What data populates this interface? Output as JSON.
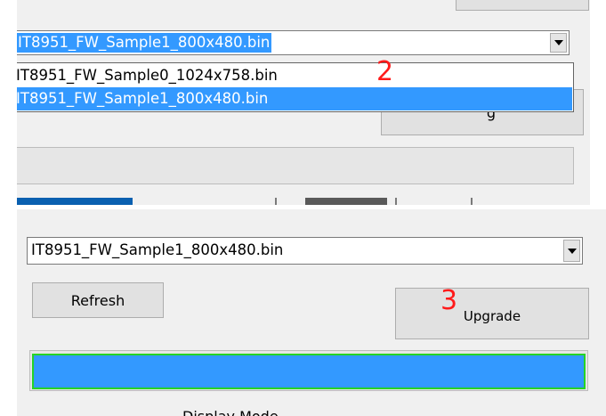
{
  "top": {
    "combo_value": "IT8951_FW_Sample1_800x480.bin",
    "dropdown_items": [
      "IT8951_FW_Sample0_1024x758.bin",
      "IT8951_FW_Sample1_800x480.bin"
    ],
    "step_annotation": "2",
    "partial_button_label": "g"
  },
  "bottom": {
    "combo_value": "IT8951_FW_Sample1_800x480.bin",
    "refresh_label": "Refresh",
    "upgrade_label": "Upgrade",
    "step_annotation": "3",
    "progress_fraction": 1.0,
    "display_mode_label": "Display Mode"
  },
  "colors": {
    "selection": "#3399ff",
    "annotation": "#ff1a1a",
    "progress_border": "#26d326"
  },
  "icons": {
    "dropdown_arrow": "chevron-down-icon"
  }
}
